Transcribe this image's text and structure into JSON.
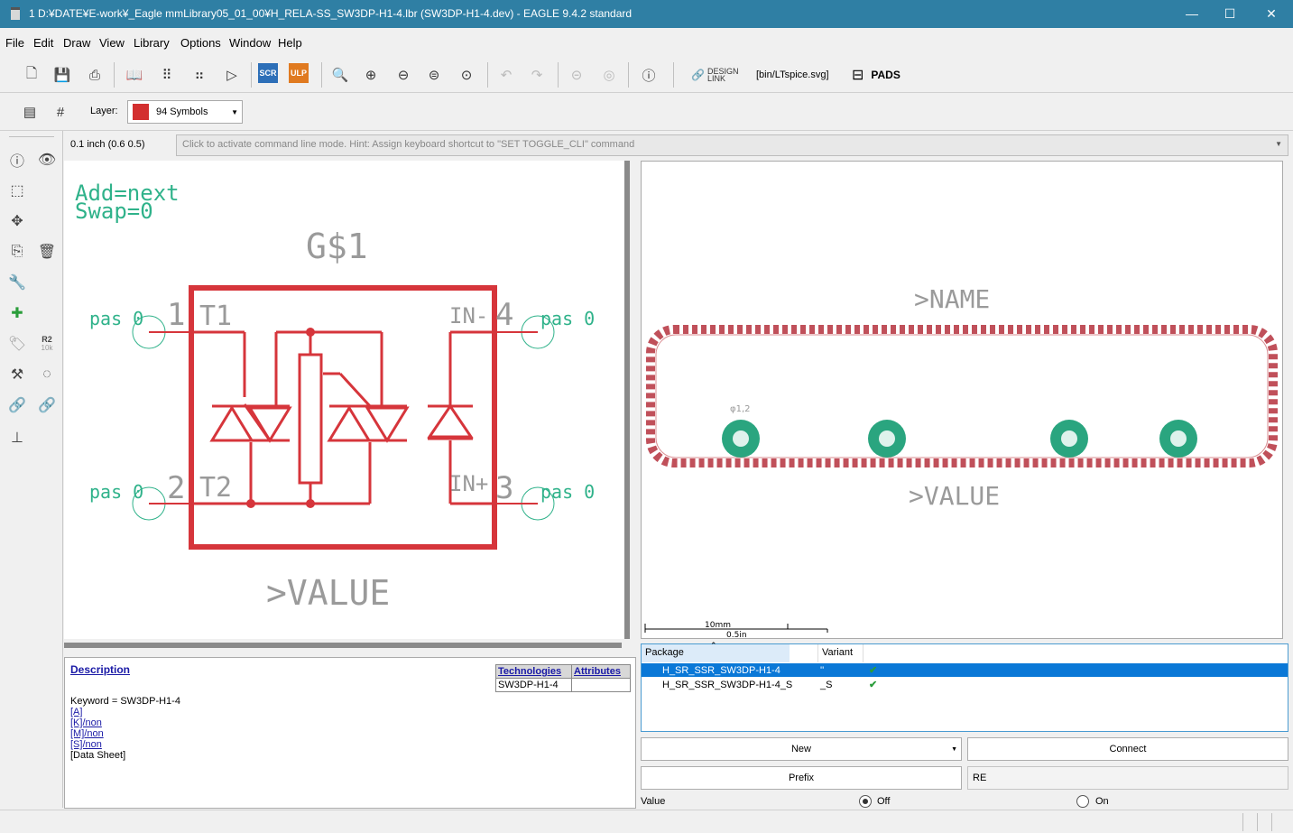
{
  "titlebar": {
    "title": "1 D:¥DATE¥E-work¥_Eagle mmLibrary05_01_00¥H_RELA-SS_SW3DP-H1-4.lbr (SW3DP-H1-4.dev) - EAGLE 9.4.2 standard",
    "minimize": "—",
    "maximize": "☐",
    "close": "✕"
  },
  "menu": [
    "File",
    "Edit",
    "Draw",
    "View",
    "Library",
    "Options",
    "Window",
    "Help"
  ],
  "toolbar": {
    "scr_label": "SCR",
    "ulp_label": "ULP",
    "design_link_line1": "DESIGN",
    "design_link_line2": "LINK",
    "ltspice_label": "[bin/LTspice.svg]",
    "pads_label": "PADS",
    "layer_label": "Layer:",
    "layer_value": "94 Symbols",
    "layer_color": "#d32f2f"
  },
  "leftbar": {
    "r2_label": "R2",
    "r2_sub": "10k"
  },
  "coordinate": "0.1 inch (0.6 0.5)",
  "command_hint": "Click to activate command line mode. Hint: Assign keyboard shortcut to \"SET TOGGLE_CLI\" command",
  "schematic": {
    "add_text": "Add=next",
    "swap_text": "Swap=0",
    "name_text": "G$1",
    "value_text": ">VALUE",
    "pins": [
      {
        "dir": "pas",
        "swap": "0",
        "num": "1",
        "name": "T1"
      },
      {
        "dir": "pas",
        "swap": "0",
        "num": "4",
        "name": "IN-"
      },
      {
        "dir": "pas",
        "swap": "0",
        "num": "2",
        "name": "T2"
      },
      {
        "dir": "pas",
        "swap": "0",
        "num": "3",
        "name": "IN+"
      }
    ],
    "symbol_color": "#d6353b",
    "pin_color": "#2fb28a",
    "text_gray": "#9a9a9a"
  },
  "package_view": {
    "name_text": ">NAME",
    "value_text": ">VALUE",
    "pad_label": "φ1,2",
    "scale_top": "10mm",
    "scale_bottom": "0.5in",
    "pad_color": "#2aa57f"
  },
  "description": {
    "heading": "Description",
    "keyword": "Keyword = SW3DP-H1-4",
    "links": [
      "[A]",
      "[K]/non",
      "[M]/non",
      "[S]/non"
    ],
    "datasheet": "[Data Sheet]",
    "tab_technologies": "Technologies",
    "tab_attributes": "Attributes",
    "technology_value": "SW3DP-H1-4"
  },
  "package_table": {
    "col_package": "Package",
    "col_variant": "Variant",
    "rows": [
      {
        "package": "H_SR_SSR_SW3DP-H1-4",
        "variant": "''",
        "check": "✔"
      },
      {
        "package": "H_SR_SSR_SW3DP-H1-4_S",
        "variant": "_S",
        "check": "✔"
      }
    ]
  },
  "buttons": {
    "new": "New",
    "connect": "Connect",
    "prefix": "Prefix",
    "prefix_value": "RE"
  },
  "value_row": {
    "label": "Value",
    "off": "Off",
    "on": "On"
  }
}
